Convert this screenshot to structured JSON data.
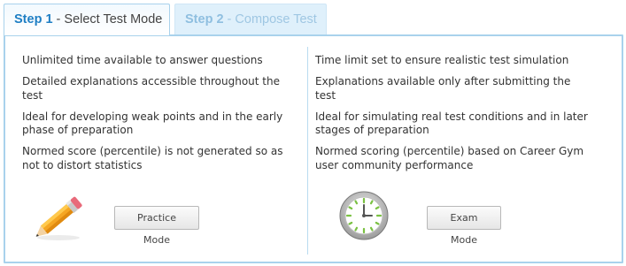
{
  "tabs": [
    {
      "step": "Step 1",
      "label": "- Select Test Mode"
    },
    {
      "step": "Step 2",
      "label": "- Compose Test"
    }
  ],
  "practice": {
    "items": [
      "Unlimited time available to answer questions",
      "Detailed explanations accessible throughout the test",
      "Ideal for developing weak points and in the early phase of preparation",
      "Normed score (percentile) is not generated so as not to distort statistics"
    ],
    "button_label": "Practice Mode",
    "icon": "pencil-icon"
  },
  "exam": {
    "items": [
      "Time limit set to ensure realistic test simulation",
      "Explanations available only after submitting the test",
      "Ideal for simulating real test conditions and in later stages of preparation",
      "Normed scoring (percentile) based on Career Gym user community performance"
    ],
    "button_label": "Exam Mode",
    "icon": "clock-icon"
  },
  "colors": {
    "accent": "#1f7fc4",
    "border": "#a9d2ec",
    "inactive_tab_bg": "#dff0fb"
  }
}
